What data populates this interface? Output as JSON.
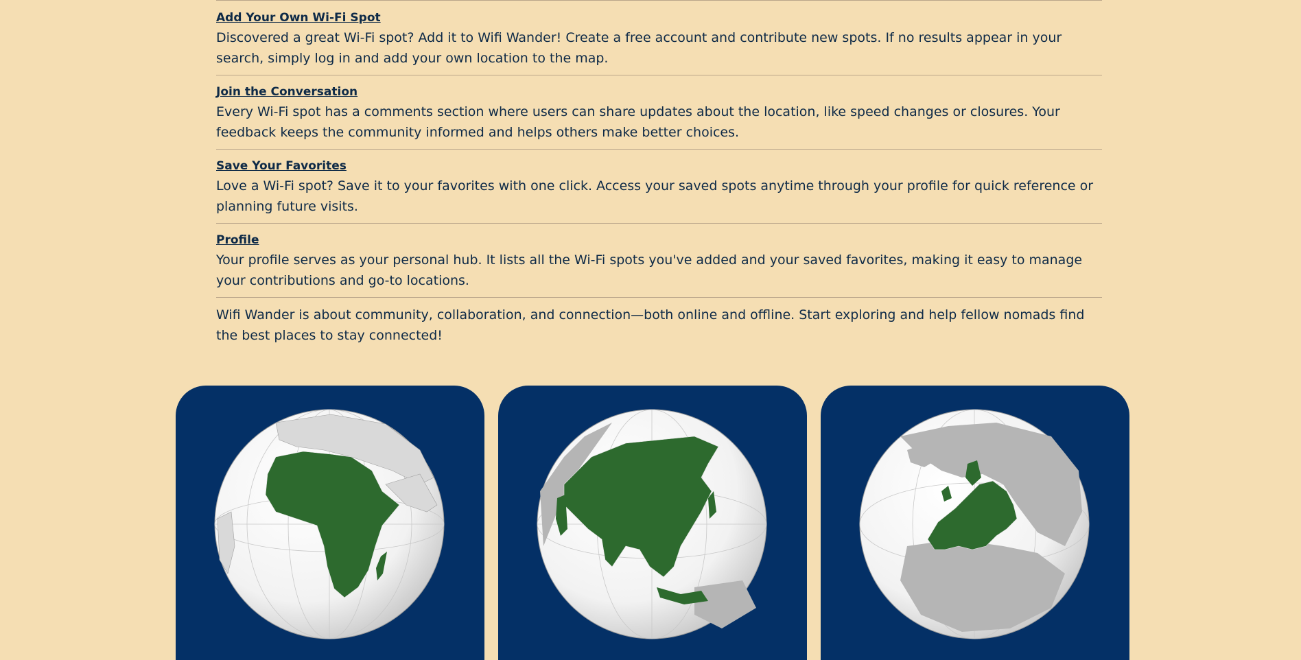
{
  "sections": [
    {
      "title": "Add Your Own Wi-Fi Spot",
      "text": "Discovered a great Wi-Fi spot? Add it to Wifi Wander! Create a free account and contribute new spots. If no results appear in your search, simply log in and add your own location to the map."
    },
    {
      "title": "Join the Conversation",
      "text": "Every Wi-Fi spot has a comments section where users can share updates about the location, like speed changes or closures. Your feedback keeps the community informed and helps others make better choices."
    },
    {
      "title": "Save Your Favorites",
      "text": "Love a Wi-Fi spot? Save it to your favorites with one click. Access your saved spots anytime through your profile for quick reference or planning future visits."
    },
    {
      "title": "Profile",
      "text": "Your profile serves as your personal hub. It lists all the Wi-Fi spots you've added and your saved favorites, making it easy to manage your contributions and go-to locations."
    }
  ],
  "closing": "Wifi Wander is about community, collaboration, and connection—both online and offline. Start exploring and help fellow nomads find the best places to stay connected!",
  "cards": [
    {
      "region_icon": "africa-globe-icon"
    },
    {
      "region_icon": "asia-globe-icon"
    },
    {
      "region_icon": "europe-globe-icon"
    }
  ],
  "colors": {
    "background": "#f5deb3",
    "text": "#0e2a47",
    "card": "#043066",
    "highlight": "#2d6a2e",
    "land": "#b5b5b5"
  }
}
